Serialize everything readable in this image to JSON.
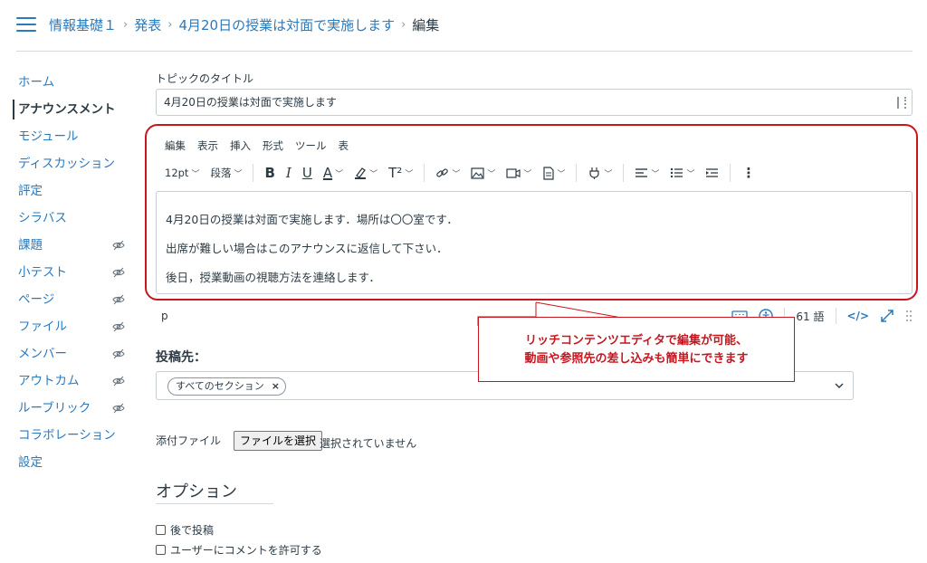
{
  "breadcrumb": {
    "course": "情報基礎１",
    "section": "発表",
    "topic": "4月20日の授業は対面で実施します",
    "current": "編集"
  },
  "sidebar": {
    "items": [
      {
        "label": "ホーム",
        "hidden": false
      },
      {
        "label": "アナウンスメント",
        "hidden": false,
        "active": true
      },
      {
        "label": "モジュール",
        "hidden": false
      },
      {
        "label": "ディスカッション",
        "hidden": false
      },
      {
        "label": "評定",
        "hidden": false
      },
      {
        "label": "シラバス",
        "hidden": false
      },
      {
        "label": "課題",
        "hidden": true
      },
      {
        "label": "小テスト",
        "hidden": true
      },
      {
        "label": "ページ",
        "hidden": true
      },
      {
        "label": "ファイル",
        "hidden": true
      },
      {
        "label": "メンバー",
        "hidden": true
      },
      {
        "label": "アウトカム",
        "hidden": true
      },
      {
        "label": "ルーブリック",
        "hidden": true
      },
      {
        "label": "コラボレーション",
        "hidden": false
      },
      {
        "label": "設定",
        "hidden": false
      }
    ]
  },
  "topic": {
    "title_label": "トピックのタイトル",
    "title_value": "4月20日の授業は対面で実施します"
  },
  "editor": {
    "menu": [
      "編集",
      "表示",
      "挿入",
      "形式",
      "ツール",
      "表"
    ],
    "font_size": "12pt",
    "block_format": "段落",
    "content": [
      "4月20日の授業は対面で実施します．場所は〇〇室です．",
      "出席が難しい場合はこのアナウンスに返信して下さい．",
      "後日，授業動画の視聴方法を連絡します．"
    ],
    "status_element": "p",
    "word_count": "61 語",
    "html_toggle": "</>"
  },
  "callout": {
    "line1": "リッチコンテンツエディタで編集が可能、",
    "line2": "動画や参照先の差し込みも簡単にできます"
  },
  "post_to": {
    "label": "投稿先：",
    "chip": "すべてのセクション",
    "chip_remove": "×"
  },
  "attachment": {
    "label": "添付ファイル",
    "button": "ファイルを選択",
    "status": "選択されていません"
  },
  "options": {
    "title": "オプション",
    "checks": [
      "後で投稿",
      "ユーザーにコメントを許可する"
    ]
  },
  "colors": {
    "link": "#2b7abc",
    "text": "#2d3b45",
    "callout": "#c9151e",
    "border": "#c7cdd1"
  }
}
